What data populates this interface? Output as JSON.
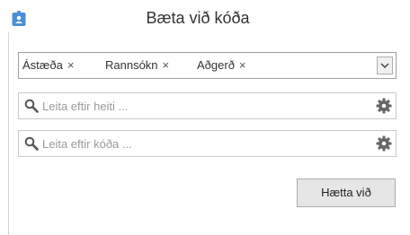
{
  "header": {
    "title": "Bæta við kóða",
    "icon": "contact-card-icon",
    "accent": "#4a8ed9"
  },
  "tags": [
    {
      "label": "Ástæða"
    },
    {
      "label": "Rannsókn"
    },
    {
      "label": "Aðgerð"
    }
  ],
  "remove_glyph": "×",
  "search_name": {
    "placeholder": "Leita eftir heiti ...",
    "value": ""
  },
  "search_code": {
    "placeholder": "Leita eftir kóða ...",
    "value": ""
  },
  "buttons": {
    "cancel": "Hætta við"
  }
}
